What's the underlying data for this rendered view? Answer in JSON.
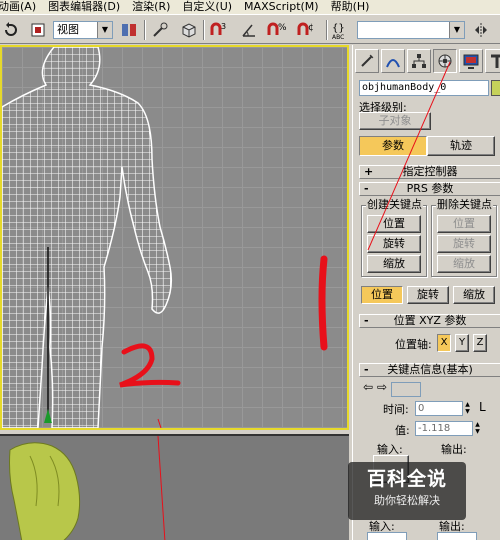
{
  "menu": {
    "items": [
      "动画(A)",
      "图表编辑器(D)",
      "渲染(R)",
      "自定义(U)",
      "MAXScript(M)",
      "帮助(H)"
    ]
  },
  "toolbar": {
    "view_select": "视图",
    "named_selection": ""
  },
  "panel": {
    "object_name": "objhumanBody_0",
    "selection_level_label": "选择级别:",
    "sub_object_button": "子对象",
    "tabs": {
      "params": "参数",
      "trajectory": "轨迹"
    },
    "rollout_assign_controller": "指定控制器",
    "rollout_prs": "PRS 参数",
    "create_key_group": "创建关键点",
    "delete_key_group": "删除关键点",
    "create_buttons": [
      "位置",
      "旋转",
      "缩放"
    ],
    "delete_buttons": [
      "位置",
      "旋转",
      "缩放"
    ],
    "mode_buttons": [
      "位置",
      "旋转",
      "缩放"
    ],
    "active_mode": "位置",
    "rollout_position_xyz": "位置 XYZ 参数",
    "position_axis_label": "位置轴:",
    "axes": [
      "X",
      "Y",
      "Z"
    ],
    "active_axis": "X",
    "rollout_key_info": "关键点信息(基本)",
    "time_label": "时间:",
    "time_value": "0",
    "value_label": "值:",
    "value_value": "-1.118",
    "in_label": "输入:",
    "out_label": "输出:",
    "in_label_2": "输入:",
    "out_label_2": "输出:"
  },
  "annotations": {
    "mark_1": "1",
    "mark_2": "2"
  },
  "watermark": {
    "title": "百科全说",
    "subtitle": "助你轻松解决"
  },
  "colors": {
    "viewport_border": "#e6d92a",
    "annotation_red": "#e8101a",
    "active_button": "#f5c85a",
    "object_color": "#c5d15a"
  }
}
